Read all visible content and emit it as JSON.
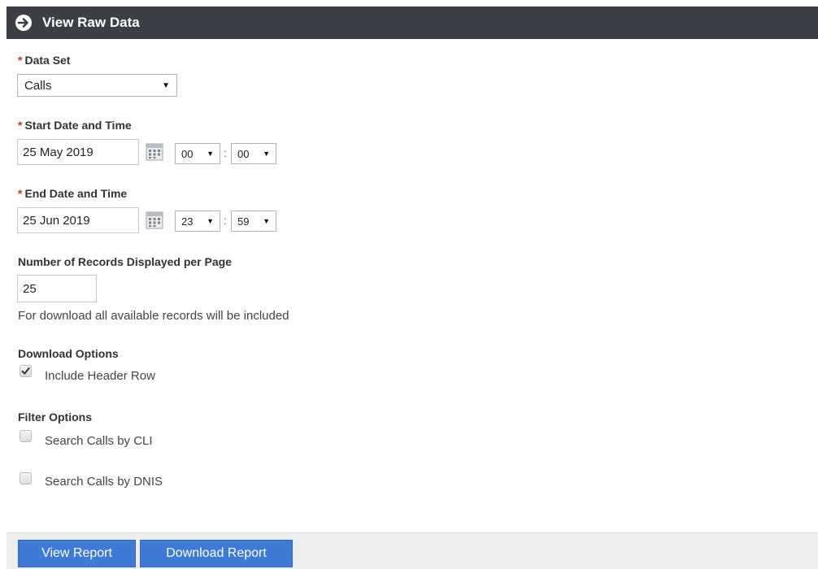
{
  "header": {
    "title": "View Raw Data",
    "icon": "arrow-circle-right-icon"
  },
  "form": {
    "required_marker": "*",
    "data_set": {
      "label": "Data Set",
      "value": "Calls"
    },
    "start": {
      "label": "Start Date and Time",
      "date": "25 May 2019",
      "hour": "00",
      "minute": "00"
    },
    "end": {
      "label": "End Date and Time",
      "date": "25 Jun 2019",
      "hour": "23",
      "minute": "59"
    },
    "time_separator": ":",
    "records": {
      "label": "Number of Records Displayed per Page",
      "value": "25",
      "helper": "For download all available records will be included"
    },
    "download_options": {
      "label": "Download Options",
      "include_header_row": {
        "label": "Include Header Row",
        "checked": true
      }
    },
    "filter_options": {
      "label": "Filter Options",
      "by_cli": {
        "label": "Search Calls by CLI",
        "checked": false
      },
      "by_dnis": {
        "label": "Search Calls by DNIS",
        "checked": false
      }
    }
  },
  "footer": {
    "view_report": "View Report",
    "download_report": "Download Report"
  },
  "colors": {
    "header_bg": "#3c3f46",
    "button_bg": "#3f7ad7",
    "required": "#c0392b"
  }
}
